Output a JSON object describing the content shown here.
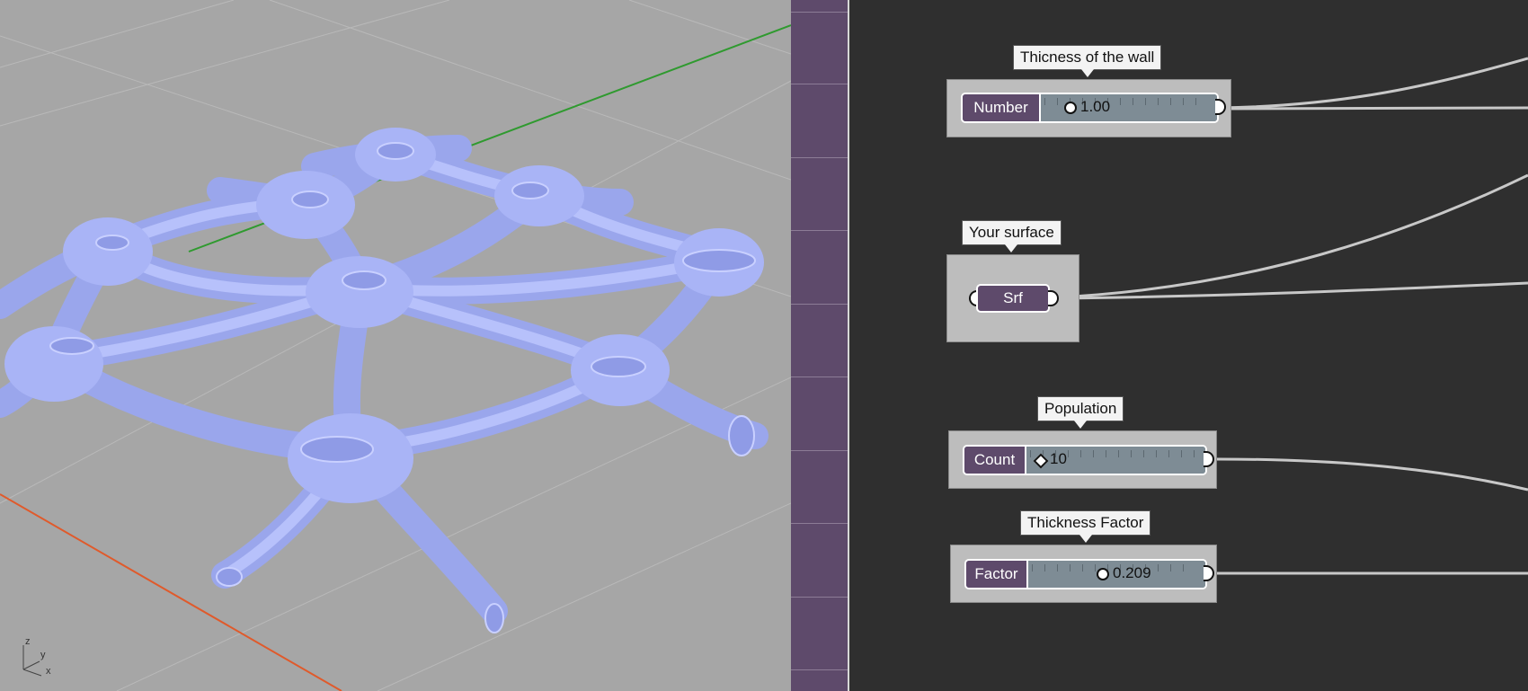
{
  "viewport": {
    "axes_icon": {
      "z": "z",
      "y": "y",
      "x": "x"
    },
    "colors": {
      "background": "#a6a6a6",
      "mesh": "#a9b4f6",
      "x_axis": "#e05a2b",
      "y_axis": "#2f9a2f"
    }
  },
  "sidebar": {
    "color": "#5e4a6b"
  },
  "canvas": {
    "wall_thickness": {
      "tooltip": "Thicness of the wall",
      "label": "Number",
      "value": "1.00"
    },
    "surface": {
      "tooltip": "Your surface",
      "label": "Srf"
    },
    "population": {
      "tooltip": "Population",
      "label": "Count",
      "value": "10"
    },
    "thickness_factor": {
      "tooltip": "Thickness Factor",
      "label": "Factor",
      "value": "0.209"
    }
  }
}
